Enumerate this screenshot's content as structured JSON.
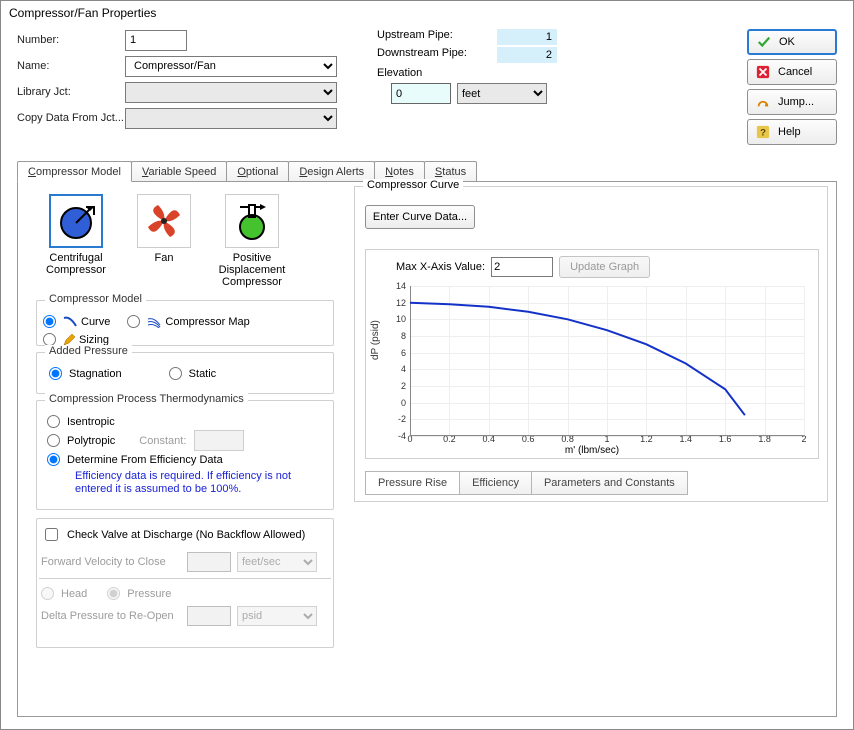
{
  "title": "Compressor/Fan Properties",
  "buttons": {
    "ok": "OK",
    "cancel": "Cancel",
    "jump": "Jump...",
    "help": "Help"
  },
  "fields": {
    "number_label": "Number:",
    "number_value": "1",
    "name_label": "Name:",
    "name_value": "Compressor/Fan",
    "library_label": "Library Jct:",
    "library_value": "",
    "copy_label": "Copy Data From Jct...",
    "copy_value": ""
  },
  "pipes": {
    "upstream_label": "Upstream Pipe:",
    "upstream_value": "1",
    "downstream_label": "Downstream Pipe:",
    "downstream_value": "2",
    "elevation_label": "Elevation",
    "elevation_value": "0",
    "elevation_unit": "feet"
  },
  "tabs": [
    "Compressor Model",
    "Variable Speed",
    "Optional",
    "Design Alerts",
    "Notes",
    "Status"
  ],
  "types": {
    "centrifugal": "Centrifugal Compressor",
    "fan": "Fan",
    "positive": "Positive Displacement Compressor"
  },
  "comp_model": {
    "legend": "Compressor Model",
    "curve": "Curve",
    "map": "Compressor Map",
    "sizing": "Sizing"
  },
  "added_pressure": {
    "legend": "Added Pressure",
    "stagnation": "Stagnation",
    "static": "Static"
  },
  "thermo": {
    "legend": "Compression Process Thermodynamics",
    "isentropic": "Isentropic",
    "polytropic": "Polytropic",
    "constant_label": "Constant:",
    "determine": "Determine From Efficiency Data",
    "note": "Efficiency data is required. If efficiency is not entered it is assumed to be 100%."
  },
  "check_valve": {
    "label": "Check Valve at Discharge (No Backflow Allowed)",
    "fv_label": "Forward Velocity to Close",
    "fv_unit": "feet/sec",
    "head": "Head",
    "pressure": "Pressure",
    "dp_label": "Delta Pressure to Re-Open",
    "dp_unit": "psid"
  },
  "curve": {
    "legend": "Compressor Curve",
    "enter_btn": "Enter Curve Data...",
    "maxx_label": "Max X-Axis Value:",
    "maxx_value": "2",
    "update_btn": "Update Graph",
    "sub_tabs": [
      "Pressure Rise",
      "Efficiency",
      "Parameters and Constants"
    ]
  },
  "chart_data": {
    "type": "line",
    "title": "",
    "xlabel": "m' (lbm/sec)",
    "ylabel": "dP (psid)",
    "xlim": [
      0,
      2
    ],
    "ylim": [
      -4,
      14
    ],
    "xticks": [
      0,
      0.2,
      0.4,
      0.6,
      0.8,
      1,
      1.2,
      1.4,
      1.6,
      1.8,
      2
    ],
    "yticks": [
      -4,
      -2,
      0,
      2,
      4,
      6,
      8,
      10,
      12,
      14
    ],
    "series": [
      {
        "name": "dP",
        "x": [
          0,
          0.2,
          0.4,
          0.6,
          0.8,
          1.0,
          1.2,
          1.4,
          1.6,
          1.7
        ],
        "y": [
          12.0,
          11.8,
          11.5,
          10.9,
          10.0,
          8.7,
          7.0,
          4.7,
          1.6,
          -1.5
        ]
      }
    ]
  }
}
